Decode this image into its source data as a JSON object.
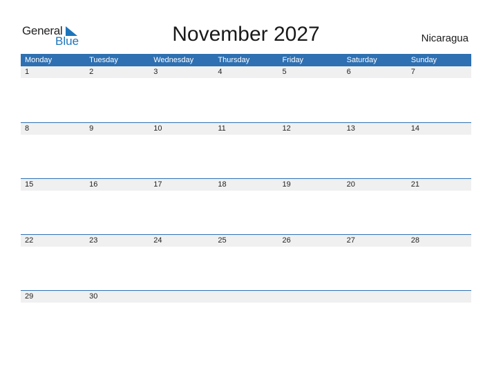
{
  "logo": {
    "general": "General",
    "blue": "Blue"
  },
  "title": "November 2027",
  "country": "Nicaragua",
  "colors": {
    "header": "#2e70b2",
    "dayrow": "#f0f0f0",
    "brand": "#1c75bc"
  },
  "weekdays": [
    "Monday",
    "Tuesday",
    "Wednesday",
    "Thursday",
    "Friday",
    "Saturday",
    "Sunday"
  ],
  "weeks": [
    [
      "1",
      "2",
      "3",
      "4",
      "5",
      "6",
      "7"
    ],
    [
      "8",
      "9",
      "10",
      "11",
      "12",
      "13",
      "14"
    ],
    [
      "15",
      "16",
      "17",
      "18",
      "19",
      "20",
      "21"
    ],
    [
      "22",
      "23",
      "24",
      "25",
      "26",
      "27",
      "28"
    ],
    [
      "29",
      "30",
      "",
      "",
      "",
      "",
      ""
    ]
  ]
}
